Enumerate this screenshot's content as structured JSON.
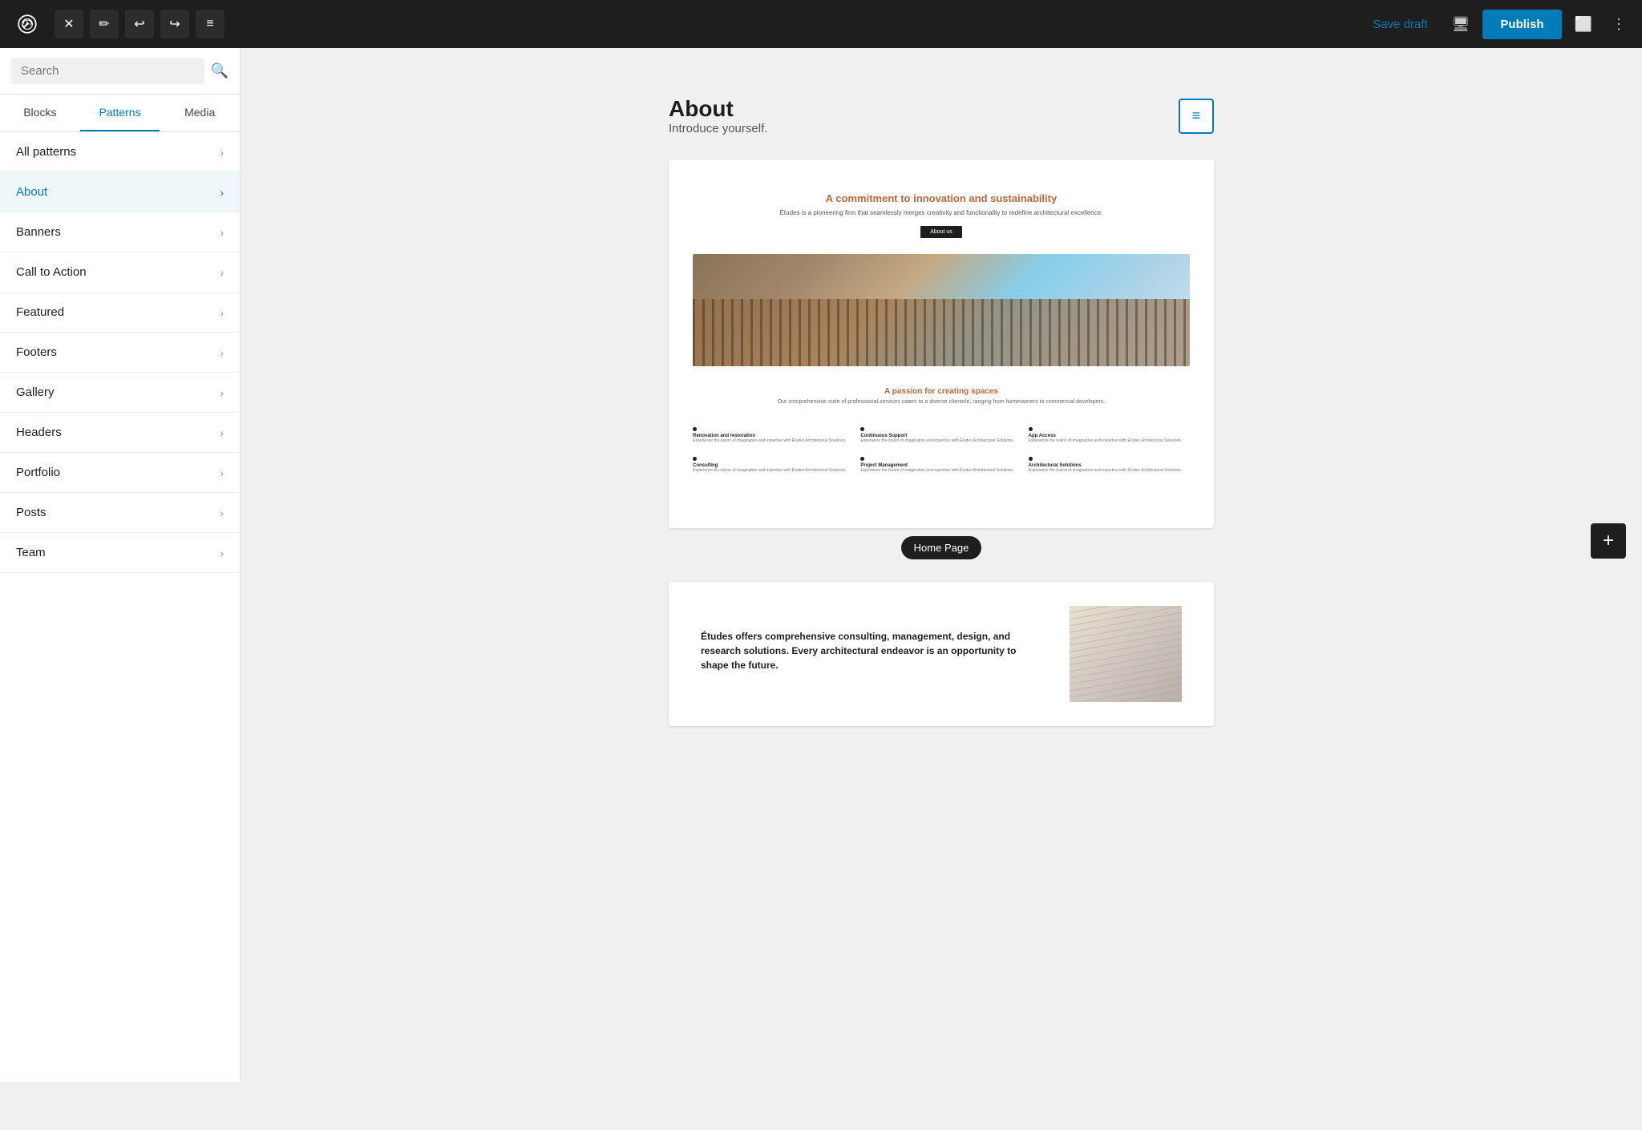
{
  "toolbar": {
    "wp_logo_alt": "WordPress Logo",
    "close_label": "×",
    "edit_label": "✏",
    "undo_label": "↩",
    "redo_label": "↪",
    "list_label": "≡",
    "save_draft": "Save draft",
    "publish": "Publish",
    "view_icon": "🖥",
    "sidebar_icon": "⬜",
    "more_icon": "⋮"
  },
  "sidebar": {
    "search_placeholder": "Search",
    "tabs": [
      {
        "id": "blocks",
        "label": "Blocks"
      },
      {
        "id": "patterns",
        "label": "Patterns"
      },
      {
        "id": "media",
        "label": "Media"
      }
    ],
    "active_tab": "patterns",
    "nav_items": [
      {
        "id": "all-patterns",
        "label": "All patterns",
        "active": false
      },
      {
        "id": "about",
        "label": "About",
        "active": true
      },
      {
        "id": "banners",
        "label": "Banners",
        "active": false
      },
      {
        "id": "call-to-action",
        "label": "Call to Action",
        "active": false
      },
      {
        "id": "featured",
        "label": "Featured",
        "active": false
      },
      {
        "id": "footers",
        "label": "Footers",
        "active": false
      },
      {
        "id": "gallery",
        "label": "Gallery",
        "active": false
      },
      {
        "id": "headers",
        "label": "Headers",
        "active": false
      },
      {
        "id": "portfolio",
        "label": "Portfolio",
        "active": false
      },
      {
        "id": "posts",
        "label": "Posts",
        "active": false
      },
      {
        "id": "team",
        "label": "Team",
        "active": false
      }
    ]
  },
  "main": {
    "page_title": "About",
    "page_subtitle": "Introduce yourself.",
    "pattern_badge": "Home Page",
    "mock_site": {
      "hero_title": "A commitment to innovation and sustainability",
      "hero_sub": "Études is a pioneering firm that seamlessly merges creativity and functionality to redefine architectural excellence.",
      "hero_btn": "About us",
      "passion_title": "A passion for creating spaces",
      "passion_sub": "Our comprehensive suite of professional services caters to a diverse clientele, ranging from homeowners to commercial developers.",
      "services": [
        {
          "title": "Renovation and restoration",
          "text": "Experience the fusion of imagination and expertise with Études Architectural Solutions."
        },
        {
          "title": "Continuous Support",
          "text": "Experience the fusion of imagination and expertise with Études Architectural Solutions."
        },
        {
          "title": "App Access",
          "text": "Experience the fusion of imagination and expertise with Études Architectural Solutions."
        },
        {
          "title": "Consulting",
          "text": "Experience the fusion of imagination and expertise with Études Architectural Solutions."
        },
        {
          "title": "Project Management",
          "text": "Experience the fusion of imagination and expertise with Études Architectural Solutions."
        },
        {
          "title": "Architectural Solutions",
          "text": "Experience the fusion of imagination and expertise with Études Architectural Solutions."
        }
      ]
    },
    "mock_site_2": {
      "heading": "Études offers comprehensive consulting, management, design, and research solutions. Every architectural endeavor is an opportunity to shape the future."
    },
    "add_btn_label": "+"
  }
}
